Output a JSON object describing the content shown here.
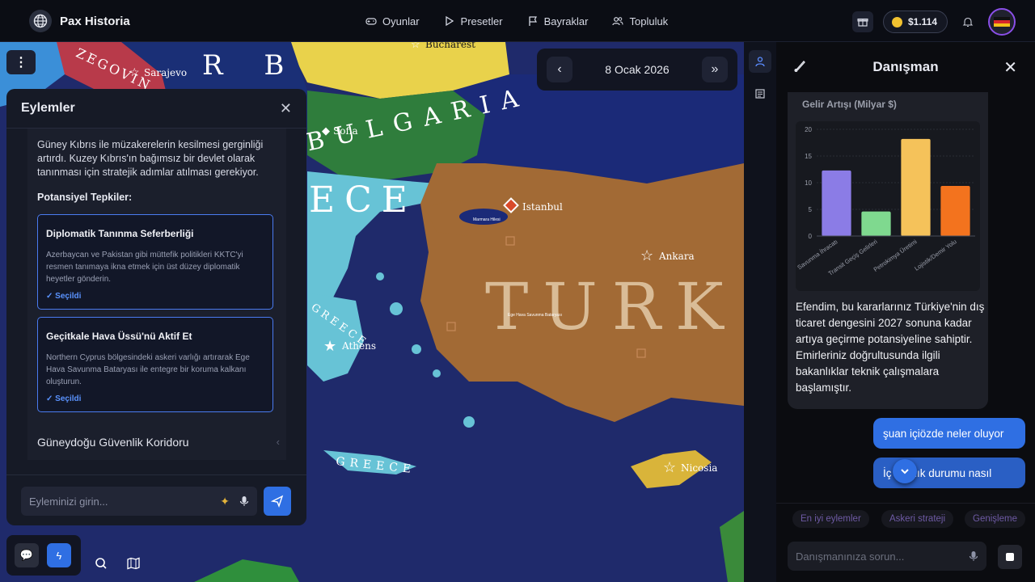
{
  "app": {
    "name": "Pax Historia"
  },
  "nav": {
    "items": [
      {
        "label": "Oyunlar",
        "icon": "gamepad-icon"
      },
      {
        "label": "Presetler",
        "icon": "play-icon"
      },
      {
        "label": "Bayraklar",
        "icon": "flag-icon"
      },
      {
        "label": "Topluluk",
        "icon": "users-icon"
      }
    ]
  },
  "wallet": {
    "balance": "$1.114"
  },
  "date_bar": {
    "date": "8 Ocak 2026"
  },
  "map": {
    "regions": [
      "BULGARIA",
      "GREECE",
      "TURKEY"
    ],
    "region_visible_text": {
      "bulgaria": "BULGARIA",
      "greece": "ECE",
      "greece_small": "GREECE",
      "greece_islands": "GREECE",
      "turkey": "TURK",
      "serbia_fragment": "R B",
      "herzegovina_fragment": "ZEGOVIN"
    },
    "cities": [
      {
        "name": "Bucharest"
      },
      {
        "name": "Sarajevo"
      },
      {
        "name": "Sofia"
      },
      {
        "name": "Istanbul"
      },
      {
        "name": "Ankara"
      },
      {
        "name": "Athens"
      },
      {
        "name": "Nicosia"
      }
    ],
    "tiny_labels": [
      "Marmara Hilesi",
      "Ege Hava Savunma Bataryası"
    ]
  },
  "actions_panel": {
    "title": "Eylemler",
    "description": "Güney Kıbrıs ile müzakerelerin kesilmesi gerginliği artırdı. Kuzey Kıbrıs'ın bağımsız bir devlet olarak tanınması için stratejik adımlar atılması gerekiyor.",
    "subheading": "Potansiyel Tepkiler:",
    "options": [
      {
        "title": "Diplomatik Tanınma Seferberliği",
        "description": "Azerbaycan ve Pakistan gibi müttefik politikleri KKTC'yi resmen tanımaya ikna etmek için üst düzey diplomatik heyetler gönderin.",
        "status": "✓ Seçildi"
      },
      {
        "title": "Geçitkale Hava Üssü'nü Aktif Et",
        "description": "Northern Cyprus bölgesindeki askeri varlığı artırarak Ege Hava Savunma Bataryası ile entegre bir koruma kalkanı oluşturun.",
        "status": "✓ Seçildi"
      }
    ],
    "collapsed_item": "Güneydoğu Güvenlik Koridoru",
    "input_placeholder": "Eyleminizi girin..."
  },
  "advisor_panel": {
    "title": "Danışman",
    "message_text": "Efendim, bu kararlarınız Türkiye'nin dış ticaret dengesini 2027 sonuna kadar artıya geçirme potansiyeline sahiptir. Emirleriniz doğrultusunda ilgili bakanlıklar teknik çalışmalara başlamıştır.",
    "user_messages": [
      "şuan içiözde neler oluyor",
      "İç ...klılık durumu nasıl"
    ],
    "suggestions": [
      "En iyi eylemler",
      "Askeri strateji",
      "Genişleme"
    ],
    "input_placeholder": "Danışmanınıza sorun..."
  },
  "chart_data": {
    "type": "bar",
    "title": "Gelir Artışı (Milyar $)",
    "categories": [
      "Savunma İhracatı",
      "Transit Geçiş Gelirleri",
      "Petrokimya Üretimi",
      "Lojistik/Demir Yolu"
    ],
    "values": [
      12.3,
      4.6,
      18.2,
      9.4
    ],
    "colors": [
      "#8b7ce6",
      "#7fd98f",
      "#f5c25a",
      "#f3731e"
    ],
    "ylim": [
      0,
      20
    ],
    "yticks": [
      0,
      5,
      10,
      15,
      20
    ],
    "grid": true
  }
}
